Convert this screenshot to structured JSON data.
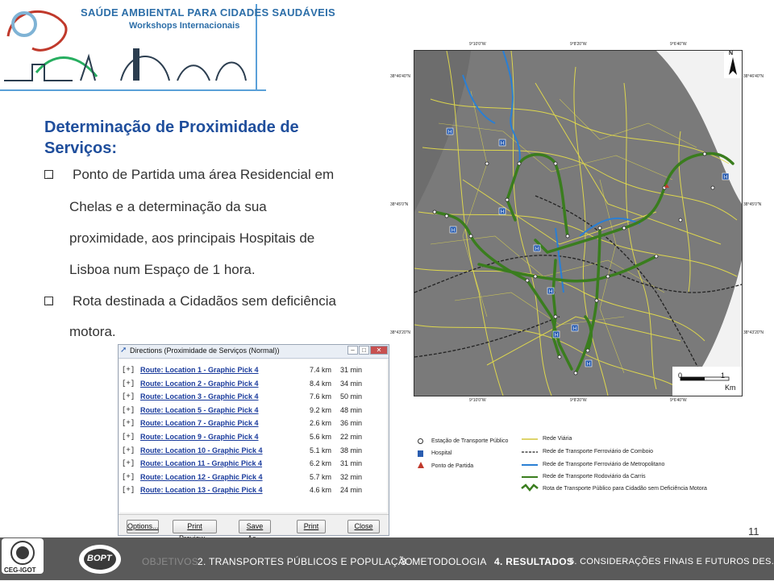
{
  "banner": {
    "title": "SAÚDE AMBIENTAL PARA CIDADES SAUDÁVEIS",
    "subtitle": "Workshops Internacionais"
  },
  "heading": "Determinação de Proximidade de Serviços:",
  "bullets": [
    {
      "lines": [
        "Ponto de Partida uma área Residencial em",
        "Chelas e a determinação da sua",
        "proximidade, aos principais Hospitais de",
        "Lisboa num Espaço de 1 hora."
      ]
    },
    {
      "lines": [
        "Rota destinada a Cidadãos sem deficiência",
        "motora."
      ]
    }
  ],
  "map": {
    "coords": {
      "top": [
        "9°10'0\"W",
        "9°8'20\"W",
        "9°6'40\"W"
      ],
      "bottom": [
        "9°10'0\"W",
        "9°8'20\"W",
        "9°6'40\"W"
      ],
      "left": [
        "38°46'40\"N",
        "38°45'0\"N",
        "38°43'20\"N"
      ],
      "right": [
        "38°46'40\"N",
        "38°45'0\"N",
        "38°43'20\"N"
      ]
    },
    "north": "N",
    "scale": {
      "zero": "0",
      "one": "1",
      "unit": "Km"
    },
    "hospital_glyph": "H"
  },
  "directions": {
    "title": "Directions (Proximidade de Serviços (Normal))",
    "expander": "[+]",
    "routes": [
      {
        "name": "Route: Location 1 - Graphic Pick 4",
        "distance": "7.4 km",
        "time": "31 min"
      },
      {
        "name": "Route: Location 2 - Graphic Pick 4",
        "distance": "8.4 km",
        "time": "34 min"
      },
      {
        "name": "Route: Location 3 - Graphic Pick 4",
        "distance": "7.6 km",
        "time": "50 min"
      },
      {
        "name": "Route: Location 5 - Graphic Pick 4",
        "distance": "9.2 km",
        "time": "48 min"
      },
      {
        "name": "Route: Location 7 - Graphic Pick 4",
        "distance": "2.6 km",
        "time": "36 min"
      },
      {
        "name": "Route: Location 9 - Graphic Pick 4",
        "distance": "5.6 km",
        "time": "22 min"
      },
      {
        "name": "Route: Location 10 - Graphic Pick 4",
        "distance": "5.1 km",
        "time": "38 min"
      },
      {
        "name": "Route: Location 11 - Graphic Pick 4",
        "distance": "6.2 km",
        "time": "31 min"
      },
      {
        "name": "Route: Location 12 - Graphic Pick 4",
        "distance": "5.7 km",
        "time": "32 min"
      },
      {
        "name": "Route: Location 13 - Graphic Pick 4",
        "distance": "4.6 km",
        "time": "24 min"
      }
    ],
    "buttons": [
      "Options...",
      "Print Preview...",
      "Save As...",
      "Print",
      "Close"
    ]
  },
  "legend": {
    "left": [
      "Estação de Transporte Público",
      "Hospital",
      "Ponto de Partida"
    ],
    "right": [
      "Rede Viária",
      "Rede de Transporte Ferroviário de Comboio",
      "Rede de Transporte Ferroviário de Metropolitano",
      "Rede de Transporte Rodoviário da Carris",
      "Rota de Transporte Público para Cidadão sem Deficiência Motora"
    ]
  },
  "page_number": "11",
  "footer": {
    "logos": [
      "CEG-IGOT",
      "BOPT"
    ],
    "nav": [
      "OBJETIVOS",
      "2. TRANSPORTES PÚBLICOS E POPULAÇÃO",
      "3. METODOLOGIA",
      "4. RESULTADOS",
      "5. CONSIDERAÇÕES FINAIS E FUTUROS DES."
    ]
  },
  "colors": {
    "heading": "#1f4e9c",
    "road": "#e8e04a",
    "route": "#3a7d1e",
    "metro": "#2a7fd4",
    "footer": "#5a5a5a"
  }
}
